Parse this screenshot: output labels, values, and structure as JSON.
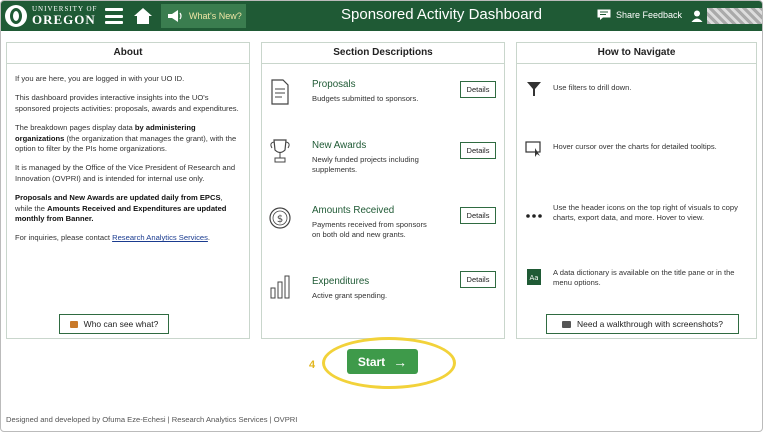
{
  "header": {
    "logo_small": "UNIVERSITY OF",
    "logo_big": "OREGON",
    "whats_new": "What's New?",
    "title": "Sponsored Activity Dashboard",
    "share_feedback": "Share Feedback",
    "accent": "#1f5a35"
  },
  "about": {
    "heading": "About",
    "p1": "If you are here, you are logged in with your UO ID.",
    "p2": "This dashboard provides interactive insights into the UO's sponsored projects activities: proposals, awards and expenditures.",
    "p3a": "The breakdown pages display data ",
    "p3b": "by administering organizations",
    "p3c": " (the organization that manages the grant), with the option to filter by the PIs home organizations.",
    "p4": "It is managed by the Office of the Vice President of Research and Innovation (OVPRI) and is intended for internal use only.",
    "p5a": "Proposals and New Awards are updated daily from EPCS",
    "p5b": ", while the ",
    "p5c": "Amounts Received and Expenditures are updated monthly from Banner.",
    "p6a": "For inquiries, please contact ",
    "p6link": "Research Analytics Services",
    "p6b": ".",
    "who_button": "Who can see what?"
  },
  "sections": {
    "heading": "Section Descriptions",
    "details_label": "Details",
    "items": [
      {
        "name": "Proposals",
        "desc": "Budgets submitted to sponsors.",
        "icon": "document-icon"
      },
      {
        "name": "New Awards",
        "desc": "Newly funded projects including supplements.",
        "icon": "trophy-icon"
      },
      {
        "name": "Amounts Received",
        "desc": "Payments received from sponsors on both old and new grants.",
        "icon": "coin-icon"
      },
      {
        "name": "Expenditures",
        "desc": "Active grant spending.",
        "icon": "bar-chart-icon"
      }
    ]
  },
  "navigate": {
    "heading": "How to Navigate",
    "items": [
      {
        "text": "Use filters to drill down.",
        "icon": "filter-icon"
      },
      {
        "text": "Hover cursor over the charts for detailed tooltips.",
        "icon": "cursor-icon"
      },
      {
        "text": "Use the header icons on the top right of visuals to copy charts, export data, and more. Hover to view.",
        "icon": "more-icon"
      },
      {
        "text": "A data dictionary is available on the title pane or in the menu options.",
        "icon": "dictionary-icon"
      }
    ],
    "walkthrough_button": "Need a walkthrough with screenshots?"
  },
  "start": {
    "step": "4",
    "label": "Start",
    "arrow": "→"
  },
  "footer": "Designed and developed by Ofuma Eze-Echesi | Research Analytics Services | OVPRI"
}
